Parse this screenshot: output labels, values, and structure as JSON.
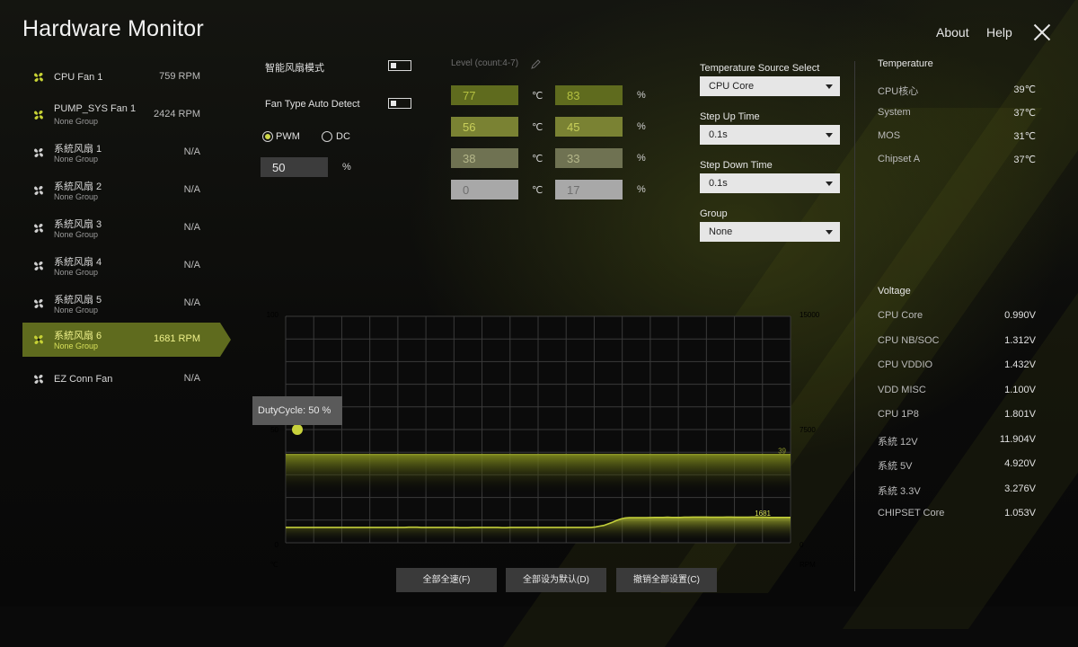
{
  "app": {
    "title": "Hardware Monitor",
    "nav": {
      "about": "About",
      "help": "Help"
    }
  },
  "fans": [
    {
      "name": "CPU Fan 1",
      "group": "",
      "value": "759 RPM"
    },
    {
      "name": "PUMP_SYS Fan 1",
      "group": "None Group",
      "value": "2424 RPM"
    },
    {
      "name": "系統风扇 1",
      "group": "None Group",
      "value": "N/A"
    },
    {
      "name": "系統风扇 2",
      "group": "None Group",
      "value": "N/A"
    },
    {
      "name": "系統风扇 3",
      "group": "None Group",
      "value": "N/A"
    },
    {
      "name": "系統风扇 4",
      "group": "None Group",
      "value": "N/A"
    },
    {
      "name": "系統风扇 5",
      "group": "None Group",
      "value": "N/A"
    },
    {
      "name": "系統风扇 6",
      "group": "None Group",
      "value": "1681 RPM"
    },
    {
      "name": "EZ Conn Fan",
      "group": "",
      "value": "N/A"
    }
  ],
  "settings": {
    "smart_fan_mode": "智能风扇模式",
    "fan_type_auto_detect": "Fan Type Auto Detect",
    "pwm": "PWM",
    "dc": "DC",
    "duty_value": "50",
    "duty_unit": "%",
    "level_label": "Level (count:4-7)"
  },
  "levels": [
    {
      "temp": "77",
      "duty": "83"
    },
    {
      "temp": "56",
      "duty": "45"
    },
    {
      "temp": "38",
      "duty": "33"
    },
    {
      "temp": "0",
      "duty": "17"
    }
  ],
  "level_units": {
    "temp": "℃",
    "duty": "%"
  },
  "controls": {
    "temp_source_label": "Temperature Source Select",
    "temp_source": "CPU Core",
    "step_up_label": "Step Up Time",
    "step_up": "0.1s",
    "step_down_label": "Step Down Time",
    "step_down": "0.1s",
    "group_label": "Group",
    "group": "None"
  },
  "temperature": {
    "heading": "Temperature",
    "rows": [
      {
        "name": "CPU核心",
        "value": "39℃"
      },
      {
        "name": "System",
        "value": "37℃"
      },
      {
        "name": "MOS",
        "value": "31℃"
      },
      {
        "name": "Chipset A",
        "value": "37℃"
      }
    ]
  },
  "voltage": {
    "heading": "Voltage",
    "rows": [
      {
        "name": "CPU Core",
        "value": "0.990V"
      },
      {
        "name": "CPU NB/SOC",
        "value": "1.312V"
      },
      {
        "name": "CPU VDDIO",
        "value": "1.432V"
      },
      {
        "name": "VDD MISC",
        "value": "1.100V"
      },
      {
        "name": "CPU 1P8",
        "value": "1.801V"
      },
      {
        "name": "系統 12V",
        "value": "11.904V"
      },
      {
        "name": "系統 5V",
        "value": "4.920V"
      },
      {
        "name": "系統 3.3V",
        "value": "3.276V"
      },
      {
        "name": "CHIPSET Core",
        "value": "1.053V"
      }
    ]
  },
  "chart": {
    "left_ticks": [
      "100",
      "50",
      "0"
    ],
    "right_ticks": [
      "15000",
      "7500",
      "0"
    ],
    "left_unit": "℃",
    "right_unit": "RPM",
    "tooltip": "DutyCycle: 50 %",
    "temp_label": "39",
    "rpm_label": "1681"
  },
  "chart_data": {
    "type": "line",
    "y_left_range": [
      0,
      100
    ],
    "y_right_range": [
      0,
      15000
    ],
    "duty_point": 50,
    "series": [
      {
        "values": [
          39,
          39,
          39,
          39,
          39,
          39,
          39,
          39,
          39,
          39,
          39,
          39,
          39,
          39,
          39,
          39,
          39,
          39,
          39,
          39,
          39,
          39,
          39,
          39,
          39,
          39,
          39,
          39,
          39,
          39,
          39,
          39,
          39,
          39,
          39,
          39,
          39,
          39,
          39,
          39,
          39,
          39,
          39,
          39,
          39,
          39,
          39,
          39,
          39,
          39,
          39,
          39,
          39,
          39,
          39,
          39,
          39,
          39,
          39,
          39,
          39,
          39,
          39,
          39,
          39,
          39,
          39,
          39,
          39,
          39,
          39,
          39,
          39,
          39,
          39,
          39,
          39,
          39,
          39,
          39,
          39,
          39,
          39,
          39,
          39,
          39,
          39,
          39,
          39,
          39,
          39,
          39,
          39,
          39,
          39,
          39,
          39,
          39,
          39,
          39,
          39,
          39,
          39,
          39,
          39,
          39,
          39,
          39,
          39,
          39,
          39,
          39,
          39,
          39,
          39,
          39,
          39,
          39,
          39,
          39
        ]
      },
      {
        "values": [
          1020,
          1020,
          1020,
          1020,
          1020,
          1020,
          1020,
          1020,
          1020,
          1020,
          1020,
          1020,
          1020,
          1020,
          1020,
          1020,
          1020,
          1020,
          1020,
          1020,
          1020,
          1020,
          1020,
          1020,
          1020,
          1020,
          1020,
          1020,
          1020,
          1030,
          1030,
          1030,
          1020,
          1020,
          1020,
          1020,
          1020,
          1020,
          1020,
          1020,
          1020,
          1000,
          1000,
          1000,
          1020,
          1020,
          1020,
          1020,
          1020,
          1020,
          1020,
          1000,
          1000,
          1020,
          1020,
          1020,
          1020,
          1020,
          1020,
          1020,
          1020,
          1020,
          1020,
          1020,
          1020,
          1020,
          1020,
          1020,
          1020,
          1020,
          1020,
          1020,
          1020,
          1050,
          1100,
          1150,
          1250,
          1350,
          1480,
          1580,
          1640,
          1660,
          1660,
          1660,
          1660,
          1660,
          1670,
          1680,
          1680,
          1680,
          1690,
          1680,
          1680,
          1680,
          1690,
          1690,
          1700,
          1700,
          1700,
          1700,
          1690,
          1690,
          1690,
          1690,
          1700,
          1700,
          1690,
          1690,
          1690,
          1690,
          1700,
          1700,
          1690,
          1690,
          1681,
          1681,
          1681,
          1681,
          1681,
          1681
        ]
      }
    ]
  }
}
